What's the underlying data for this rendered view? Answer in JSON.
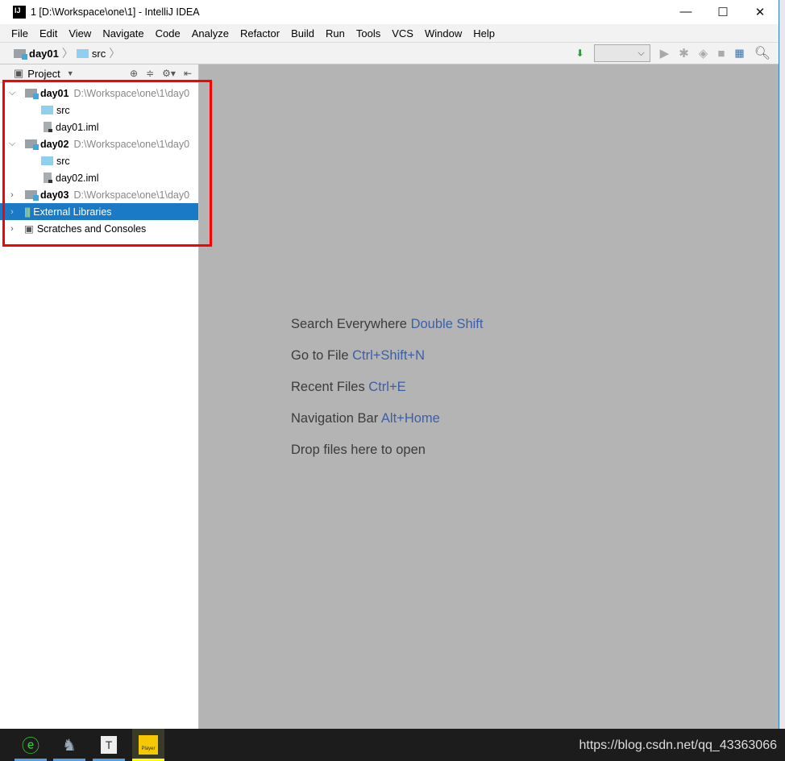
{
  "window": {
    "title": "1 [D:\\Workspace\\one\\1] - IntelliJ IDEA",
    "logo": "IJ",
    "controls": [
      "minimize-icon",
      "maximize-icon",
      "close-icon"
    ]
  },
  "menu": [
    "File",
    "Edit",
    "View",
    "Navigate",
    "Code",
    "Analyze",
    "Refactor",
    "Build",
    "Run",
    "Tools",
    "VCS",
    "Window",
    "Help"
  ],
  "breadcrumb": [
    "day01",
    "src"
  ],
  "project_panel": {
    "title": "Project",
    "tree": [
      {
        "label": "day01",
        "path": "D:\\Workspace\\one\\1\\day0",
        "bold": true,
        "expanded": true,
        "level": 0
      },
      {
        "label": "src",
        "level": 1,
        "type": "folder"
      },
      {
        "label": "day01.iml",
        "level": 1,
        "type": "file"
      },
      {
        "label": "day02",
        "path": "D:\\Workspace\\one\\1\\day0",
        "bold": true,
        "expanded": true,
        "level": 0
      },
      {
        "label": "src",
        "level": 1,
        "type": "folder"
      },
      {
        "label": "day02.iml",
        "level": 1,
        "type": "file"
      },
      {
        "label": "day03",
        "path": "D:\\Workspace\\one\\1\\day0",
        "bold": true,
        "expanded": false,
        "level": 0
      },
      {
        "label": "External Libraries",
        "selected": true,
        "level": 0
      },
      {
        "label": "Scratches and Consoles",
        "level": 0
      }
    ]
  },
  "editor_hints": [
    {
      "text": "Search Everywhere",
      "key": "Double Shift"
    },
    {
      "text": "Go to File",
      "key": "Ctrl+Shift+N"
    },
    {
      "text": "Recent Files",
      "key": "Ctrl+E"
    },
    {
      "text": "Navigation Bar",
      "key": "Alt+Home"
    },
    {
      "text": "Drop files here to open",
      "key": ""
    }
  ],
  "taskbar": {
    "player_label": "Player",
    "watermark": "https://blog.csdn.net/qq_43363066"
  },
  "colors": {
    "selection": "#1a7ac6",
    "editor_bg": "#b4b4b4",
    "highlight_box": "#ff0000",
    "shortcut": "#3c5fa8"
  }
}
